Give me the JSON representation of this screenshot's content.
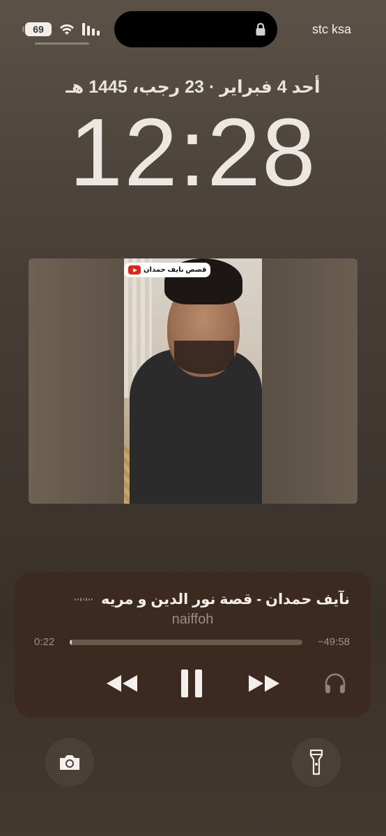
{
  "status_bar": {
    "battery_level": "69",
    "carrier": "stc ksa",
    "icons": [
      "wifi-icon",
      "cellular-signal-icon",
      "lock-icon"
    ]
  },
  "lock_screen": {
    "date": "أحد 4 فبراير · 23 رجب، 1445 هـ",
    "time": "12:28"
  },
  "video": {
    "channel_label": "قصص نايف حمدان",
    "channel_icon": "youtube-icon"
  },
  "now_playing": {
    "title": "نآيف حمدان -  قصة نور الدين و مريه",
    "artist": "naiffoh",
    "elapsed": "0:22",
    "remaining": "−49:58",
    "progress_fraction": 0.007,
    "controls": [
      "rewind-icon",
      "pause-icon",
      "fast-forward-icon",
      "headphones-icon"
    ]
  },
  "quick_actions": [
    "camera-icon",
    "flashlight-icon"
  ],
  "colors": {
    "background_top": "#5b5147",
    "player_background": "#3c2a20",
    "text_primary": "#f3efea",
    "text_secondary": "#9b8c80"
  }
}
